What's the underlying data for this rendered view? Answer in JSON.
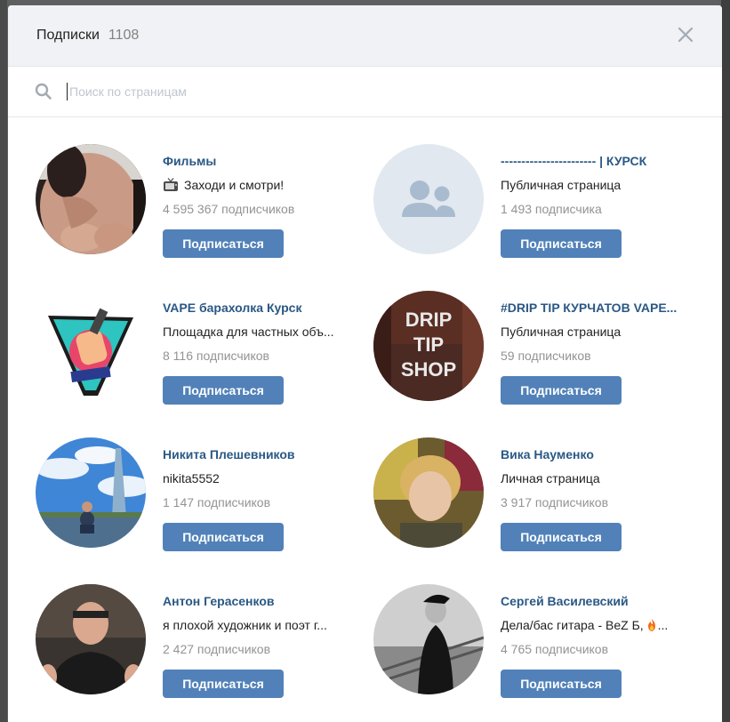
{
  "header": {
    "title": "Подписки",
    "count": "1108"
  },
  "search": {
    "placeholder": "Поиск по страницам"
  },
  "subscribe_label": "Подписаться",
  "accent_color": "#5181b8",
  "cards": [
    {
      "name": "Фильмы",
      "desc": "Заходи и смотри!",
      "desc_icon": "tv-icon",
      "subs": "4 595 367 подписчиков",
      "avatar": "photo-woman"
    },
    {
      "name": "----------------------- | КУРСК",
      "desc": "Публичная страница",
      "subs": "1 493 подписчика",
      "avatar": "default-group-icon"
    },
    {
      "name": "VAPE барахолка Курск",
      "desc": "Площадка для частных объ...",
      "subs": "8 116 подписчиков",
      "avatar": "vape-kursk-logo"
    },
    {
      "name": "#DRIP TIP КУРЧАТОВ VAPE...",
      "desc": "Публичная страница",
      "subs": "59 подписчиков",
      "avatar": "drip-tip-shop-logo",
      "avatar_text": [
        "DRIP",
        "TIP",
        "SHOP"
      ]
    },
    {
      "name": "Никита Плешевников",
      "desc": "nikita5552",
      "subs": "1 147 подписчиков",
      "avatar": "photo-sky-tower"
    },
    {
      "name": "Вика Науменко",
      "desc": "Личная страница",
      "subs": "3 917 подписчиков",
      "avatar": "photo-woman-selfie"
    },
    {
      "name": "Антон Герасенков",
      "desc": "я плохой художник и поэт г...",
      "subs": "2 427 подписчиков",
      "avatar": "photo-man-black-shirt"
    },
    {
      "name": "Сергей Василевский",
      "desc": "Дела/бас гитара - BeZ Б,",
      "desc_icon_after": "fire-icon",
      "subs": "4 765 подписчиков",
      "avatar": "photo-man-bw"
    }
  ]
}
